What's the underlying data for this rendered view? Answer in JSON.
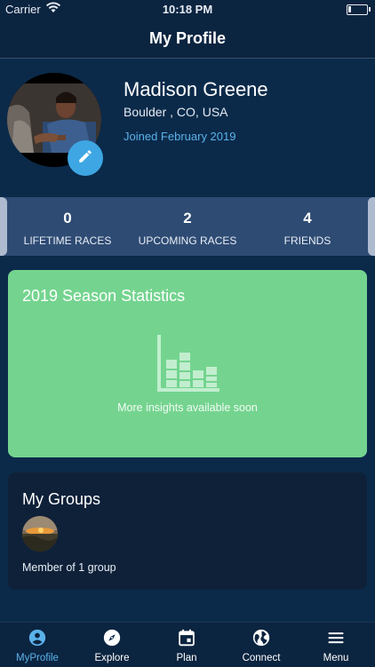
{
  "status_bar": {
    "carrier": "Carrier",
    "time": "10:18 PM"
  },
  "nav": {
    "title": "My Profile"
  },
  "profile": {
    "name": "Madison Greene",
    "location": "Boulder , CO, USA",
    "joined": "Joined February 2019"
  },
  "stats": [
    {
      "value": "0",
      "label": "LIFETIME RACES"
    },
    {
      "value": "2",
      "label": "UPCOMING RACES"
    },
    {
      "value": "4",
      "label": "FRIENDS"
    }
  ],
  "season": {
    "title": "2019 Season Statistics",
    "message": "More insights available soon"
  },
  "groups": {
    "title": "My Groups",
    "member_text": "Member of 1 group"
  },
  "tabs": [
    {
      "label": "MyProfile",
      "icon": "profile-icon",
      "active": true
    },
    {
      "label": "Explore",
      "icon": "compass-icon",
      "active": false
    },
    {
      "label": "Plan",
      "icon": "calendar-icon",
      "active": false
    },
    {
      "label": "Connect",
      "icon": "globe-icon",
      "active": false
    },
    {
      "label": "Menu",
      "icon": "menu-icon",
      "active": false
    }
  ],
  "colors": {
    "background": "#0b2a4a",
    "accent": "#3ea7e3",
    "season_card": "#74d48f",
    "groups_card": "#0f2139",
    "stats_strip": "#2e4b73"
  }
}
